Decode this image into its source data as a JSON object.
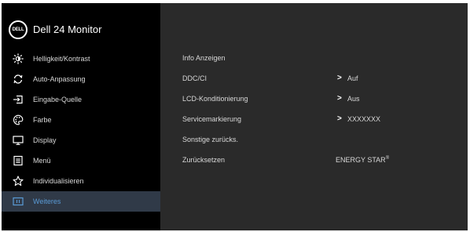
{
  "header": {
    "logo_text": "DELL",
    "title": "Dell 24 Monitor"
  },
  "sidebar": {
    "items": [
      {
        "label": "Helligkeit/Kontrast",
        "icon": "brightness-icon"
      },
      {
        "label": "Auto-Anpassung",
        "icon": "auto-adjust-icon"
      },
      {
        "label": "Eingabe-Quelle",
        "icon": "input-source-icon"
      },
      {
        "label": "Farbe",
        "icon": "color-icon"
      },
      {
        "label": "Display",
        "icon": "display-icon"
      },
      {
        "label": "Menü",
        "icon": "menu-icon"
      },
      {
        "label": "Individualisieren",
        "icon": "star-icon"
      },
      {
        "label": "Weiteres",
        "icon": "others-icon",
        "active": true
      }
    ]
  },
  "main": {
    "rows": [
      {
        "label": "Info Anzeigen",
        "value": ""
      },
      {
        "label": "DDC/CI",
        "value": "Auf",
        "has_arrow": true
      },
      {
        "label": "LCD-Konditionierung",
        "value": "Aus",
        "has_arrow": true
      },
      {
        "label": "Servicemarkierung",
        "value": "XXXXXXX",
        "has_arrow": true
      },
      {
        "label": "Sonstige zurücks.",
        "value": ""
      },
      {
        "label": "Zurücksetzen",
        "value": "ENERGY STAR",
        "value_mark": "®"
      }
    ]
  },
  "colors": {
    "osd_background": "#2a2a2a",
    "sidebar_background": "#000000",
    "active_item_background": "#303a48",
    "active_item_text": "#5a9bd6",
    "text": "#d8d8d8"
  }
}
